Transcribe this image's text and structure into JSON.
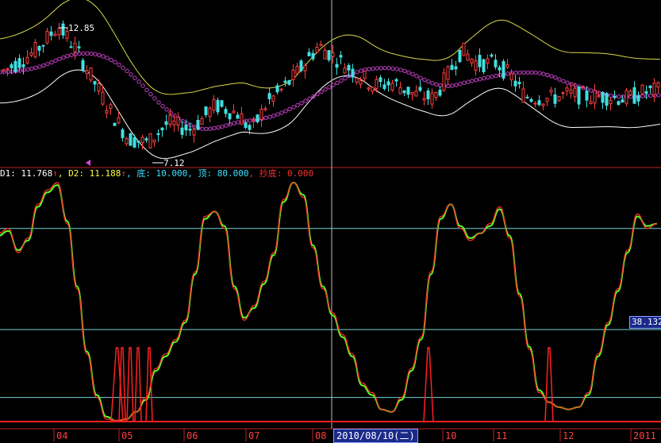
{
  "chart_data": [
    {
      "type": "candlestick",
      "annotations": {
        "high_label": "12.85",
        "low_label": "7.12"
      },
      "price_range": [
        6.5,
        13.5
      ],
      "series": [
        {
          "role": "upper-band",
          "color": "#d8d84a"
        },
        {
          "role": "middle-band",
          "color": "#ffffff"
        },
        {
          "role": "moving-average-dots",
          "color": "#c040c0"
        }
      ],
      "up_color": "#ff4040",
      "down_color": "#40e0e0"
    },
    {
      "type": "line",
      "indicator_labels": {
        "d1_prefix": "D1: ",
        "d1_value": "11.768",
        "d2_prefix": ", D2: ",
        "d2_value": "11.188",
        "bottom_prefix": ", 底: ",
        "bottom_value": "10.000",
        "top_prefix": ", 顶: ",
        "top_value": "80.000",
        "dip_prefix": ", 抄底: ",
        "dip_value": "0.000"
      },
      "ylim": [
        0,
        100
      ],
      "reference_lines": [
        80,
        38.132,
        10
      ],
      "value_tag": "38.132",
      "series": [
        {
          "role": "D1",
          "color": "#ff3030",
          "values": [
            78,
            80,
            70,
            76,
            90,
            96,
            99,
            82,
            55,
            28,
            10,
            1,
            0.5,
            1,
            4,
            10,
            22,
            28,
            34,
            42,
            62,
            85,
            87,
            80,
            55,
            42,
            48,
            58,
            70,
            92,
            99,
            93,
            72,
            55,
            45,
            36,
            28,
            16,
            12,
            5,
            4,
            10,
            22,
            35,
            62,
            85,
            90,
            80,
            75,
            78,
            82,
            89,
            76,
            52,
            30,
            12,
            8,
            6,
            5,
            6,
            12,
            28,
            41,
            55,
            71,
            86,
            80,
            82
          ]
        },
        {
          "role": "D2",
          "color": "#60ff20",
          "values": [
            77,
            79,
            71,
            75,
            89,
            95,
            98,
            83,
            56,
            29,
            11,
            2,
            0.3,
            1,
            4,
            9,
            21,
            27,
            33,
            41,
            61,
            84,
            87,
            81,
            56,
            43,
            47,
            57,
            69,
            91,
            99,
            94,
            73,
            56,
            44,
            35,
            27,
            15,
            11,
            5,
            4,
            9,
            21,
            34,
            61,
            84,
            90,
            81,
            76,
            78,
            81,
            88,
            77,
            53,
            31,
            13,
            8,
            6,
            5,
            6,
            11,
            27,
            40,
            54,
            70,
            85,
            81,
            82
          ]
        },
        {
          "role": "dip-signal",
          "color": "#ff2020"
        }
      ],
      "x_tick_labels": [
        "04",
        "05",
        "06",
        "07",
        "08",
        "10",
        "11",
        "12",
        "2011"
      ],
      "cursor_date": "2010/08/10(二)"
    }
  ]
}
